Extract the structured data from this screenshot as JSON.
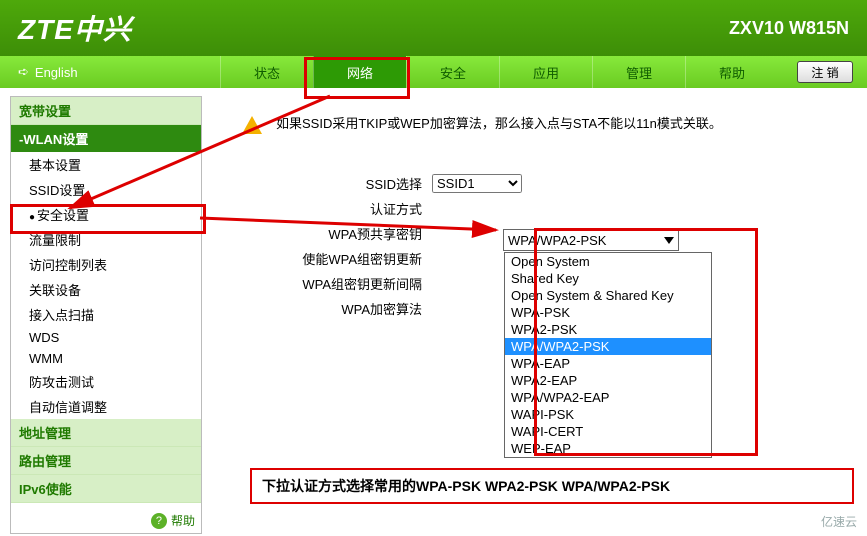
{
  "header": {
    "logo": "ZTE中兴",
    "model": "ZXV10 W815N"
  },
  "lang": {
    "label": "English"
  },
  "tabs": [
    "状态",
    "网络",
    "安全",
    "应用",
    "管理",
    "帮助"
  ],
  "active_tab": 1,
  "logout": "注 销",
  "sidebar": {
    "cat0": "宽带设置",
    "sub": "-WLAN设置",
    "items": [
      "基本设置",
      "SSID设置",
      "安全设置",
      "流量限制",
      "访问控制列表",
      "关联设备",
      "接入点扫描",
      "WDS",
      "WMM",
      "防攻击测试",
      "自动信道调整"
    ],
    "active_item": 2,
    "cat1": "地址管理",
    "cat2": "路由管理",
    "cat3": "IPv6使能",
    "help": "帮助"
  },
  "alert": "如果SSID采用TKIP或WEP加密算法，那么接入点与STA不能以11n模式关联。",
  "labels": {
    "ssid": "SSID选择",
    "auth": "认证方式",
    "psk": "WPA预共享密钥",
    "renew": "使能WPA组密钥更新",
    "interval": "WPA组密钥更新间隔",
    "algo": "WPA加密算法"
  },
  "ssid_value": "SSID1",
  "auth_value": "WPA/WPA2-PSK",
  "auth_options": [
    "Open System",
    "Shared Key",
    "Open System & Shared Key",
    "WPA-PSK",
    "WPA2-PSK",
    "WPA/WPA2-PSK",
    "WPA-EAP",
    "WPA2-EAP",
    "WPA/WPA2-EAP",
    "WAPI-PSK",
    "WAPI-CERT",
    "WEP-EAP"
  ],
  "auth_selected": 5,
  "note": "下拉认证方式选择常用的WPA-PSK  WPA2-PSK WPA/WPA2-PSK",
  "watermark": "亿速云"
}
